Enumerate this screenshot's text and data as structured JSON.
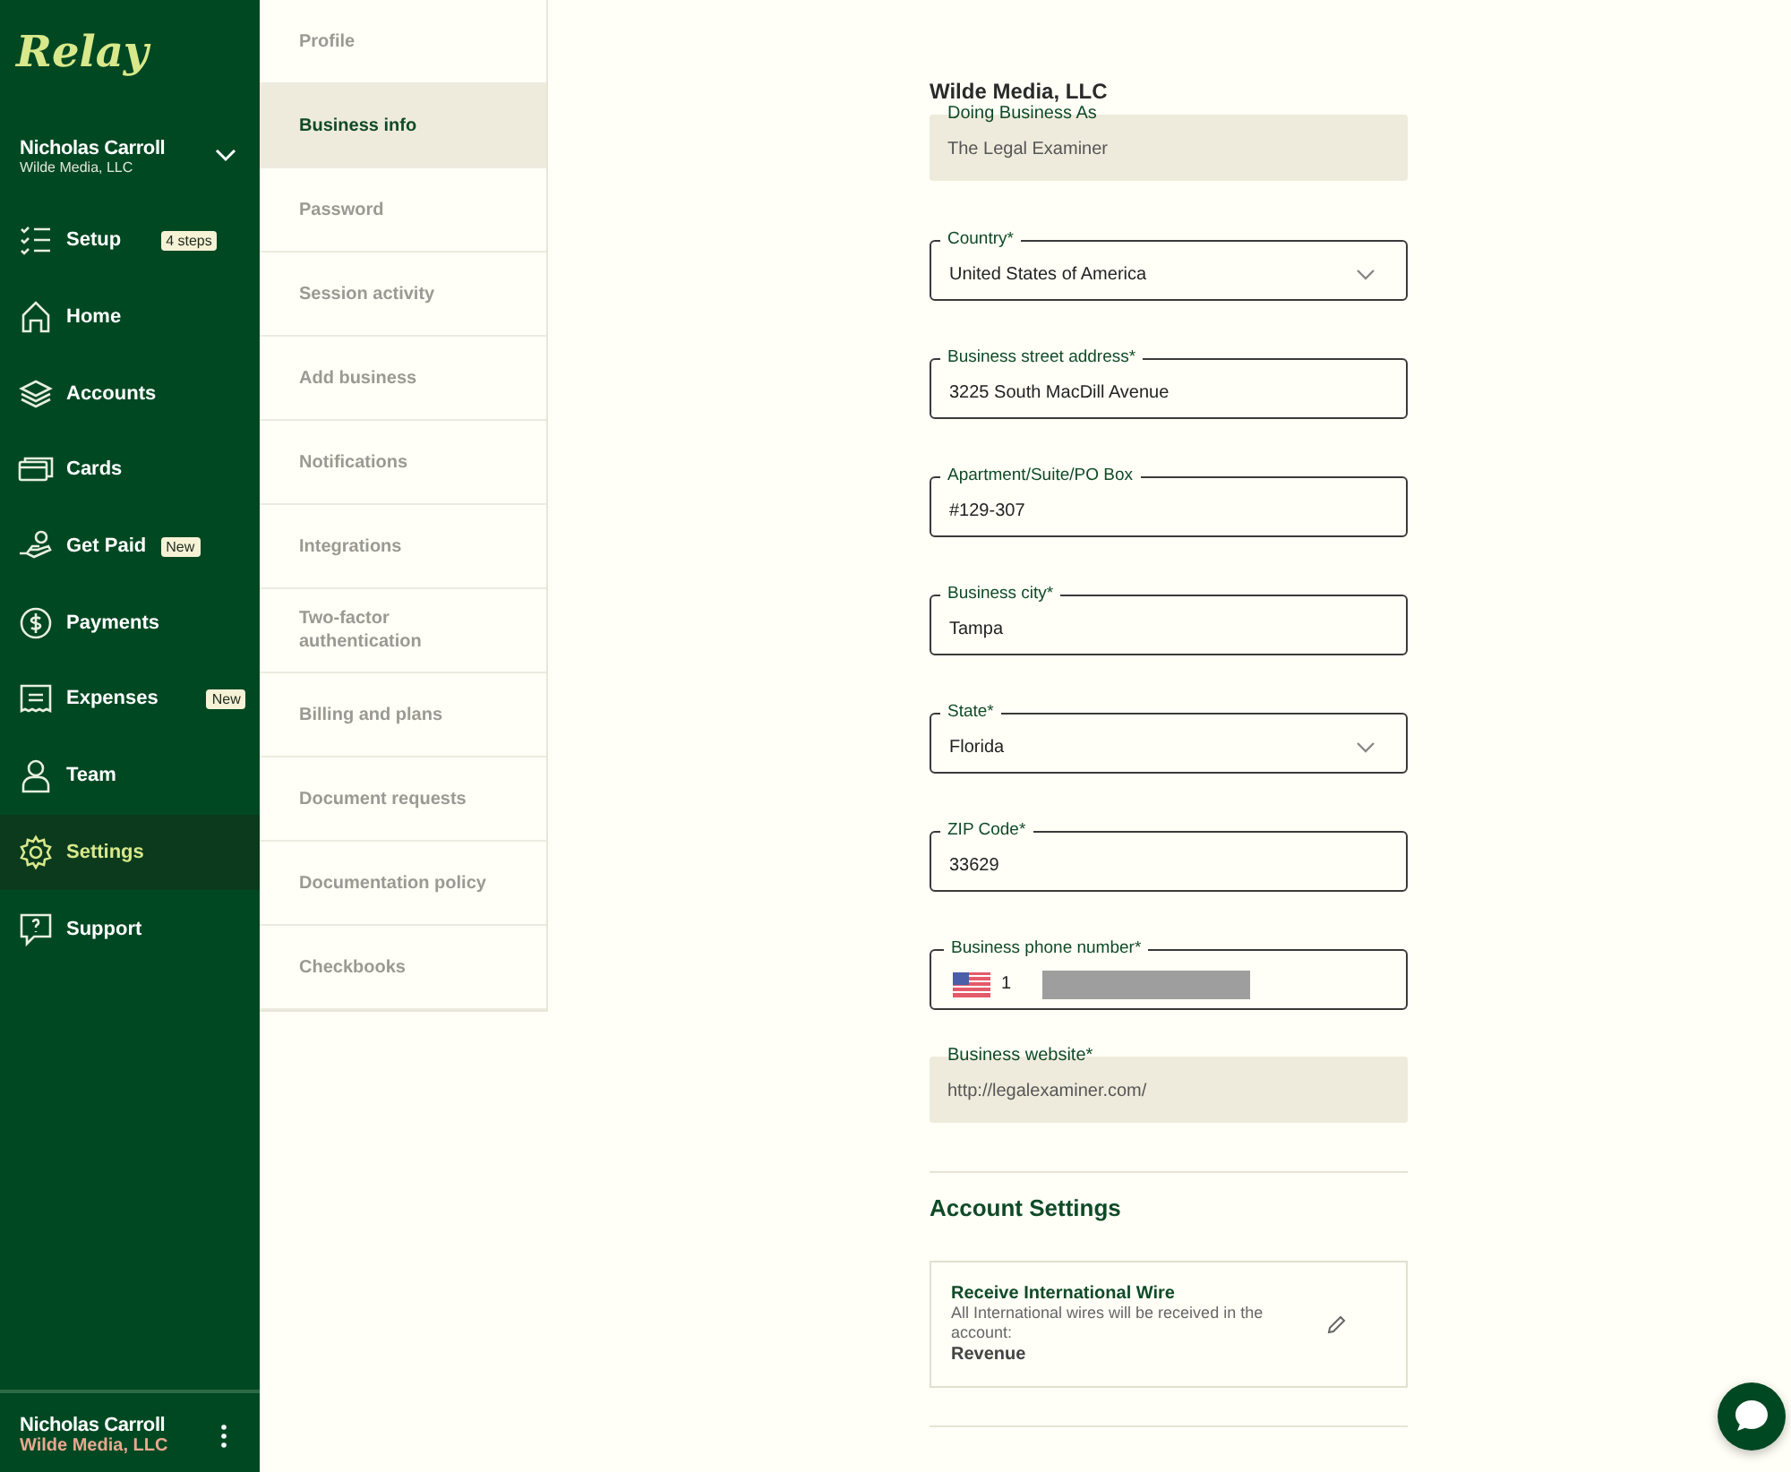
{
  "sidebar": {
    "logo": "Relay",
    "user": {
      "name": "Nicholas Carroll",
      "company": "Wilde Media, LLC"
    },
    "items": [
      {
        "label": "Setup",
        "badge": "4 steps",
        "selected": false
      },
      {
        "label": "Home",
        "selected": false
      },
      {
        "label": "Accounts",
        "selected": false
      },
      {
        "label": "Cards",
        "selected": false
      },
      {
        "label": "Get Paid",
        "badge": "New",
        "selected": false
      },
      {
        "label": "Payments",
        "selected": false
      },
      {
        "label": "Expenses",
        "badge": "New",
        "selected": false
      },
      {
        "label": "Team",
        "selected": false
      },
      {
        "label": "Settings",
        "selected": true
      },
      {
        "label": "Support",
        "selected": false
      }
    ],
    "footer": {
      "name": "Nicholas Carroll",
      "company": "Wilde Media, LLC"
    }
  },
  "settings_menu": [
    {
      "label": "Profile",
      "selected": false
    },
    {
      "label": "Business info",
      "selected": true
    },
    {
      "label": "Password",
      "selected": false
    },
    {
      "label": "Session activity",
      "selected": false
    },
    {
      "label": "Add business",
      "selected": false
    },
    {
      "label": "Notifications",
      "selected": false
    },
    {
      "label": "Integrations",
      "selected": false
    },
    {
      "label": "Two-factor authentication",
      "selected": false
    },
    {
      "label": "Billing and plans",
      "selected": false
    },
    {
      "label": "Document requests",
      "selected": false
    },
    {
      "label": "Documentation policy",
      "selected": false
    },
    {
      "label": "Checkbooks",
      "selected": false
    }
  ],
  "business_name": "Wilde Media, LLC",
  "fields": [
    {
      "kind": "readonly",
      "label": "Doing Business As",
      "value": "The Legal Examiner"
    },
    {
      "kind": "select",
      "label": "Country*",
      "value": "United States of America"
    },
    {
      "kind": "text",
      "label": "Business street address*",
      "value": "3225 South MacDill Avenue"
    },
    {
      "kind": "text",
      "label": "Apartment/Suite/PO Box",
      "value": "#129-307"
    },
    {
      "kind": "text",
      "label": "Business city*",
      "value": "Tampa"
    },
    {
      "kind": "select",
      "label": "State*",
      "value": "Florida"
    },
    {
      "kind": "text",
      "label": "ZIP Code*",
      "value": "33629"
    },
    {
      "kind": "phone",
      "label": "Business phone number*",
      "value": "1"
    },
    {
      "kind": "readonly",
      "label": "Business website*",
      "value": "http://legalexaminer.com/"
    }
  ],
  "account_settings": {
    "title": "Account Settings",
    "card": {
      "title": "Receive International Wire",
      "description": "All International wires will be received in the account:",
      "account": "Revenue"
    }
  }
}
